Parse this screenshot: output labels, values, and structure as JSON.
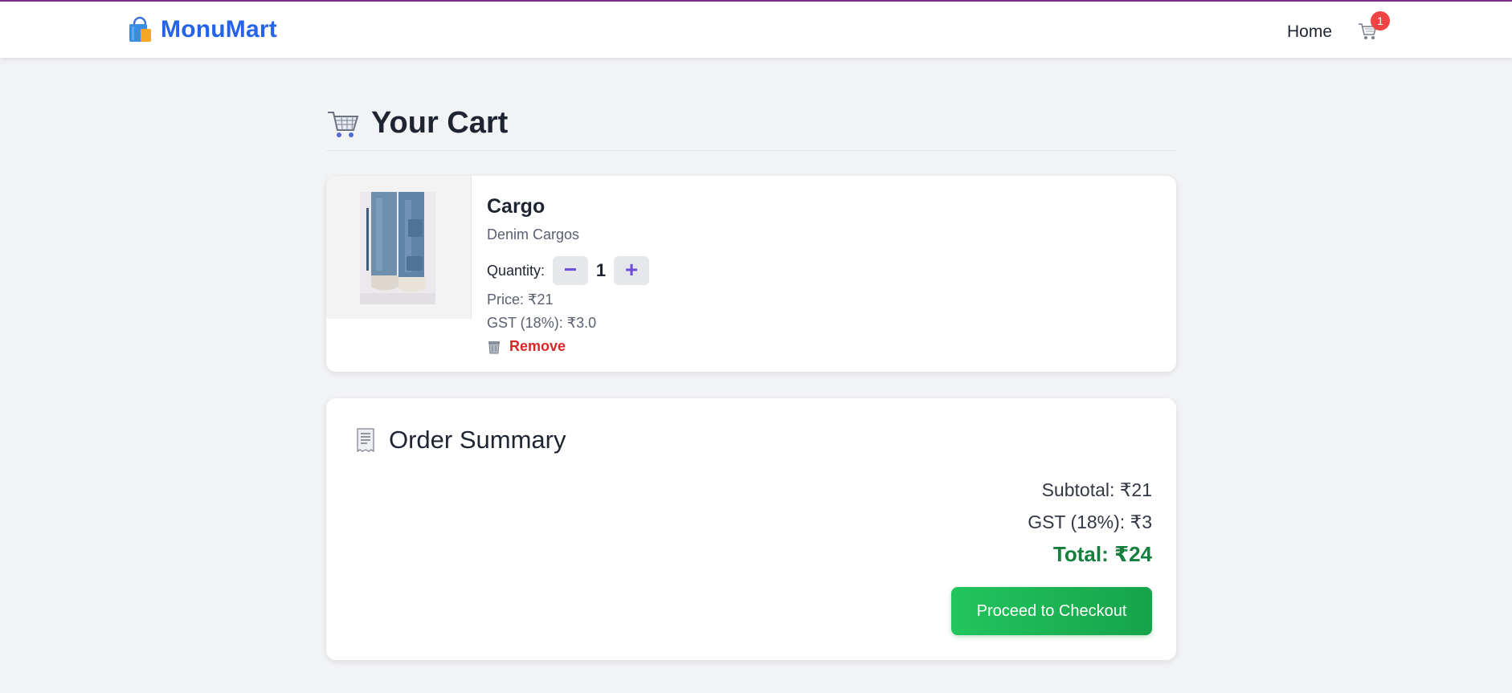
{
  "app": {
    "brand": "MonuMart"
  },
  "nav": {
    "home_label": "Home",
    "cart_count": "1"
  },
  "page": {
    "title": "Your Cart"
  },
  "cart": {
    "items": [
      {
        "name": "Cargo",
        "subtitle": "Denim Cargos",
        "quantity_label": "Quantity:",
        "quantity": "1",
        "minus_label": "−",
        "plus_label": "+",
        "price": "Price: ₹21",
        "gst": "GST (18%): ₹3.0",
        "remove_label": "Remove"
      }
    ]
  },
  "summary": {
    "title": "Order Summary",
    "subtotal": "Subtotal: ₹21",
    "gst": "GST (18%): ₹3",
    "total": "Total: ₹24",
    "checkout_label": "Proceed to Checkout"
  },
  "colors": {
    "brand": "#2563eb",
    "badge": "#ef4444",
    "remove": "#dc2626",
    "total": "#15803d",
    "checkout": "#22c55e",
    "qty_accent": "#6d4fd6"
  },
  "icons": [
    "shopping-bag-icon",
    "cart-icon",
    "shopping-cart-icon",
    "trash-icon",
    "receipt-icon"
  ]
}
